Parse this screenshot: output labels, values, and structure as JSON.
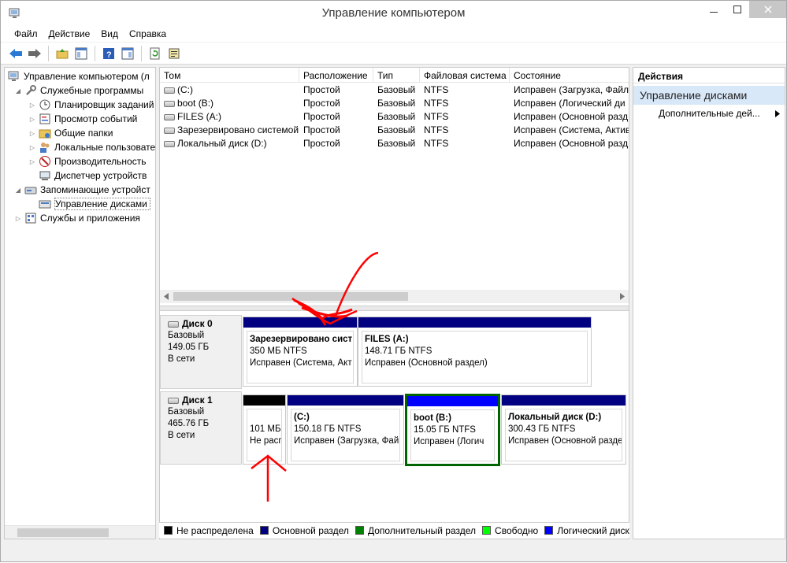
{
  "window": {
    "title": "Управление компьютером"
  },
  "menu": [
    "Файл",
    "Действие",
    "Вид",
    "Справка"
  ],
  "tree": {
    "root": "Управление компьютером (л",
    "items": [
      {
        "label": "Служебные программы"
      },
      {
        "label": "Планировщик заданий"
      },
      {
        "label": "Просмотр событий"
      },
      {
        "label": "Общие папки"
      },
      {
        "label": "Локальные пользовате"
      },
      {
        "label": "Производительность"
      },
      {
        "label": "Диспетчер устройств"
      },
      {
        "label": "Запоминающие устройст"
      },
      {
        "label": "Управление дисками"
      },
      {
        "label": "Службы и приложения"
      }
    ]
  },
  "volumes": {
    "headers": [
      "Том",
      "Расположение",
      "Тип",
      "Файловая система",
      "Состояние"
    ],
    "rows": [
      [
        "(C:)",
        "Простой",
        "Базовый",
        "NTFS",
        "Исправен (Загрузка, Файл"
      ],
      [
        "boot (B:)",
        "Простой",
        "Базовый",
        "NTFS",
        "Исправен (Логический ди"
      ],
      [
        "FILES (A:)",
        "Простой",
        "Базовый",
        "NTFS",
        "Исправен (Основной разд"
      ],
      [
        "Зарезервировано системой",
        "Простой",
        "Базовый",
        "NTFS",
        "Исправен (Система, Актив"
      ],
      [
        "Локальный диск (D:)",
        "Простой",
        "Базовый",
        "NTFS",
        "Исправен (Основной разд"
      ]
    ]
  },
  "disks": [
    {
      "name": "Диск 0",
      "type": "Базовый",
      "size": "149.05 ГБ",
      "status": "В сети",
      "partitions": [
        {
          "name": "Зарезервировано сист",
          "size": "350 МБ NTFS",
          "state": "Исправен (Система, Акт",
          "color": "#000080"
        },
        {
          "name": "FILES  (A:)",
          "size": "148.71 ГБ NTFS",
          "state": "Исправен (Основной раздел)",
          "color": "#000080"
        }
      ]
    },
    {
      "name": "Диск 1",
      "type": "Базовый",
      "size": "465.76 ГБ",
      "status": "В сети",
      "partitions": [
        {
          "name": "",
          "size": "101 МБ",
          "state": "Не расп",
          "color": "#000000"
        },
        {
          "name": "(C:)",
          "size": "150.18 ГБ NTFS",
          "state": "Исправен (Загрузка, Фай",
          "color": "#000080"
        },
        {
          "name": "boot  (B:)",
          "size": "15.05 ГБ NTFS",
          "state": "Исправен (Логич",
          "color": "#0000ff"
        },
        {
          "name": "Локальный диск  (D:)",
          "size": "300.43 ГБ NTFS",
          "state": "Исправен (Основной раздел",
          "color": "#000080"
        }
      ]
    }
  ],
  "legend": [
    {
      "label": "Не распределена",
      "color": "#000000"
    },
    {
      "label": "Основной раздел",
      "color": "#000080"
    },
    {
      "label": "Дополнительный раздел",
      "color": "#008000"
    },
    {
      "label": "Свободно",
      "color": "#00ff00"
    },
    {
      "label": "Логический диск",
      "color": "#0000ff"
    }
  ],
  "actions": {
    "header": "Действия",
    "section": "Управление дисками",
    "item": "Дополнительные дей..."
  },
  "colors": {
    "selected_border": "#006400",
    "annotation": "#ff0000"
  }
}
